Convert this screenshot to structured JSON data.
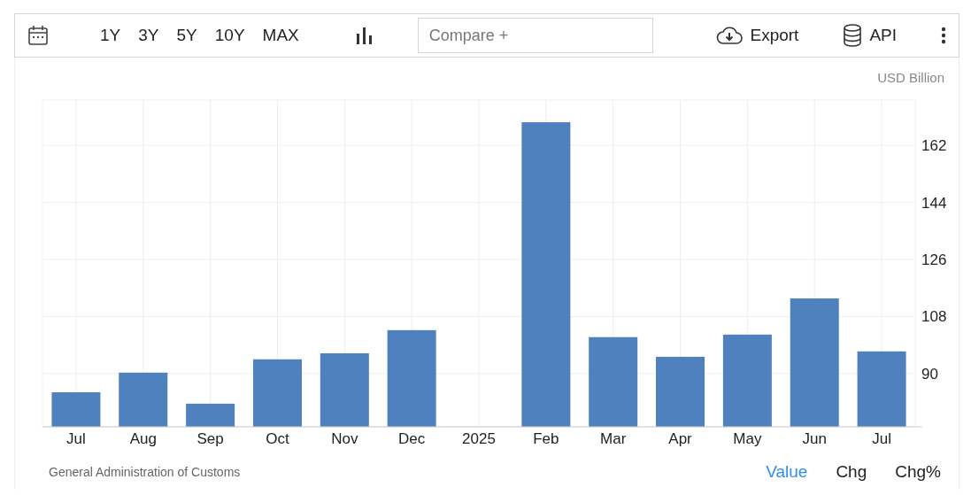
{
  "toolbar": {
    "ranges": [
      "1Y",
      "3Y",
      "5Y",
      "10Y",
      "MAX"
    ],
    "compare": {
      "placeholder": "Compare +"
    },
    "export": "Export",
    "api": "API"
  },
  "chart": {
    "unit": "USD Billion",
    "chart_data": {
      "type": "bar",
      "categories": [
        "Jul",
        "Aug",
        "Sep",
        "Oct",
        "Nov",
        "Dec",
        "2025",
        "Feb",
        "Mar",
        "Apr",
        "May",
        "Jun",
        "Jul"
      ],
      "grid": true,
      "series": [
        {
          "color": "#4e81bd",
          "values": [
            84.1,
            90.3,
            80.5,
            94.5,
            96.4,
            103.7,
            null,
            169.3,
            101.5,
            95.3,
            102.3,
            113.7,
            97.0
          ]
        }
      ],
      "ylim": [
        73.2,
        176.3
      ],
      "yticks": [
        90,
        108,
        126,
        144,
        162
      ]
    }
  },
  "footer": {
    "source": "General Administration of Customs",
    "modes": [
      {
        "label": "Value",
        "selected": true
      },
      {
        "label": "Chg",
        "selected": false
      },
      {
        "label": "Chg%",
        "selected": false
      }
    ]
  }
}
